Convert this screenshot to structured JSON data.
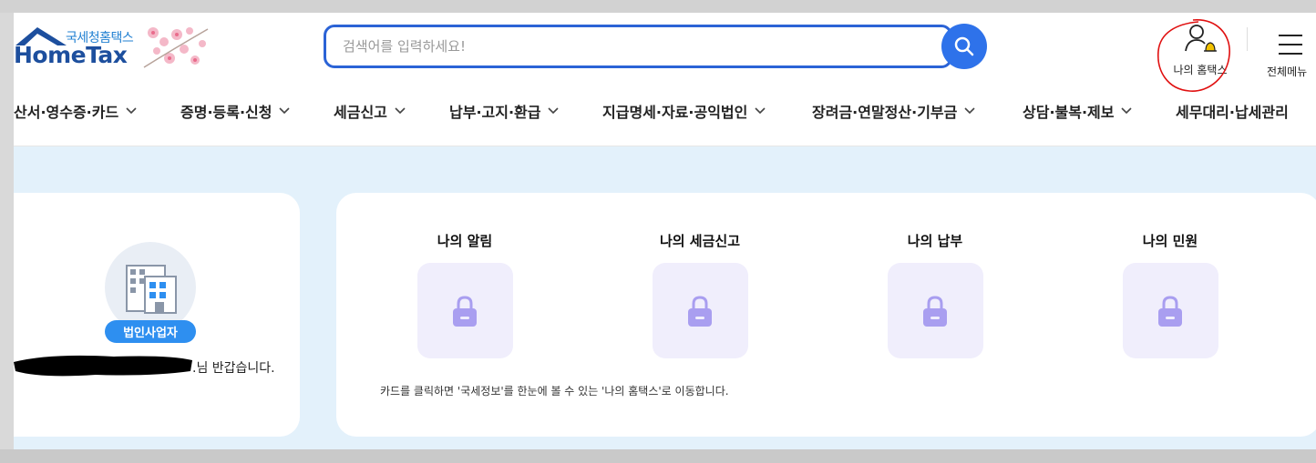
{
  "header": {
    "logo_sub": "국세청홈택스",
    "logo_main": "HomeTax",
    "search_placeholder": "검색어를 입력하세요!",
    "my_hometax_label": "나의 홈택스",
    "all_menu_label": "전체메뉴"
  },
  "nav": {
    "items": [
      {
        "label": "산서·영수증·카드"
      },
      {
        "label": "증명·등록·신청"
      },
      {
        "label": "세금신고"
      },
      {
        "label": "납부·고지·환급"
      },
      {
        "label": "지급명세·자료·공익법인"
      },
      {
        "label": "장려금·연말정산·기부금"
      },
      {
        "label": "상담·불복·제보"
      },
      {
        "label": "세무대리·납세관리"
      }
    ]
  },
  "profile": {
    "badge": "법인사업자",
    "greeting": ".님 반갑습니다."
  },
  "tiles": [
    {
      "title": "나의 알림"
    },
    {
      "title": "나의 세금신고"
    },
    {
      "title": "나의 납부"
    },
    {
      "title": "나의 민원"
    }
  ],
  "note": "카드를 클릭하면 '국세정보'를 한눈에 볼 수 있는 '나의 홈택스'로 이동합니다.",
  "colors": {
    "brand_blue": "#1d4f9e",
    "search_border": "#2b63d6",
    "badge_blue": "#2e8ff0",
    "band_bg": "#e3f1fb",
    "lock_purple": "#a99ef0"
  }
}
